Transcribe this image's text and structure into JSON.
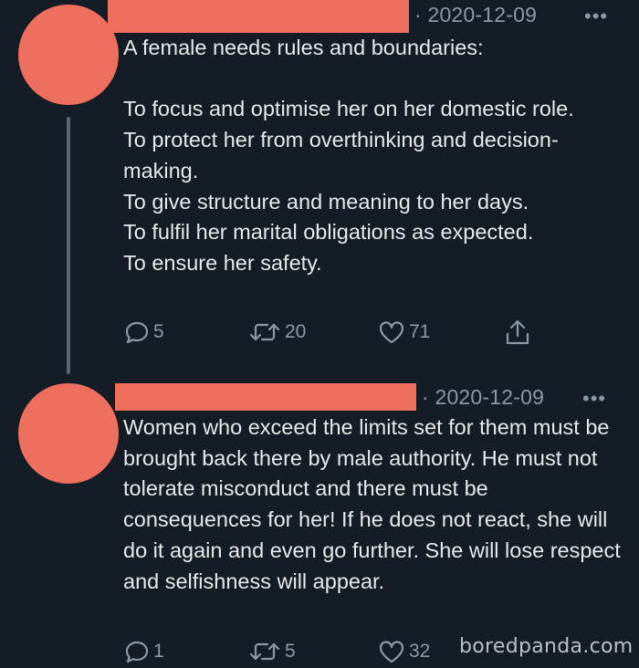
{
  "tweets": [
    {
      "meta": "· 2020-12-09",
      "more_label": "•••",
      "text": "A female needs rules and boundaries:\n\nTo focus and optimise her on her domestic role.\nTo protect her from overthinking and decision-making.\nTo give structure and meaning to her days.\nTo fulfil her marital obligations as expected.\nTo ensure her safety.",
      "replies": "5",
      "retweets": "20",
      "likes": "71"
    },
    {
      "meta": "· 2020-12-09",
      "more_label": "•••",
      "text": "Women who exceed the limits set for them must be brought back there by male authority. He must not tolerate misconduct and there must be consequences for her! If he does not react, she will do it again and even go further. She will lose respect and selfishness will appear.",
      "replies": "1",
      "retweets": "5",
      "likes": "32"
    }
  ],
  "watermark": "boredpanda.com",
  "colors": {
    "background": "#141d26",
    "redaction": "#ef6f5f",
    "text": "#e7e9ea",
    "muted": "#8b98a5"
  },
  "icons": [
    "reply-icon",
    "retweet-icon",
    "like-icon",
    "share-icon"
  ]
}
